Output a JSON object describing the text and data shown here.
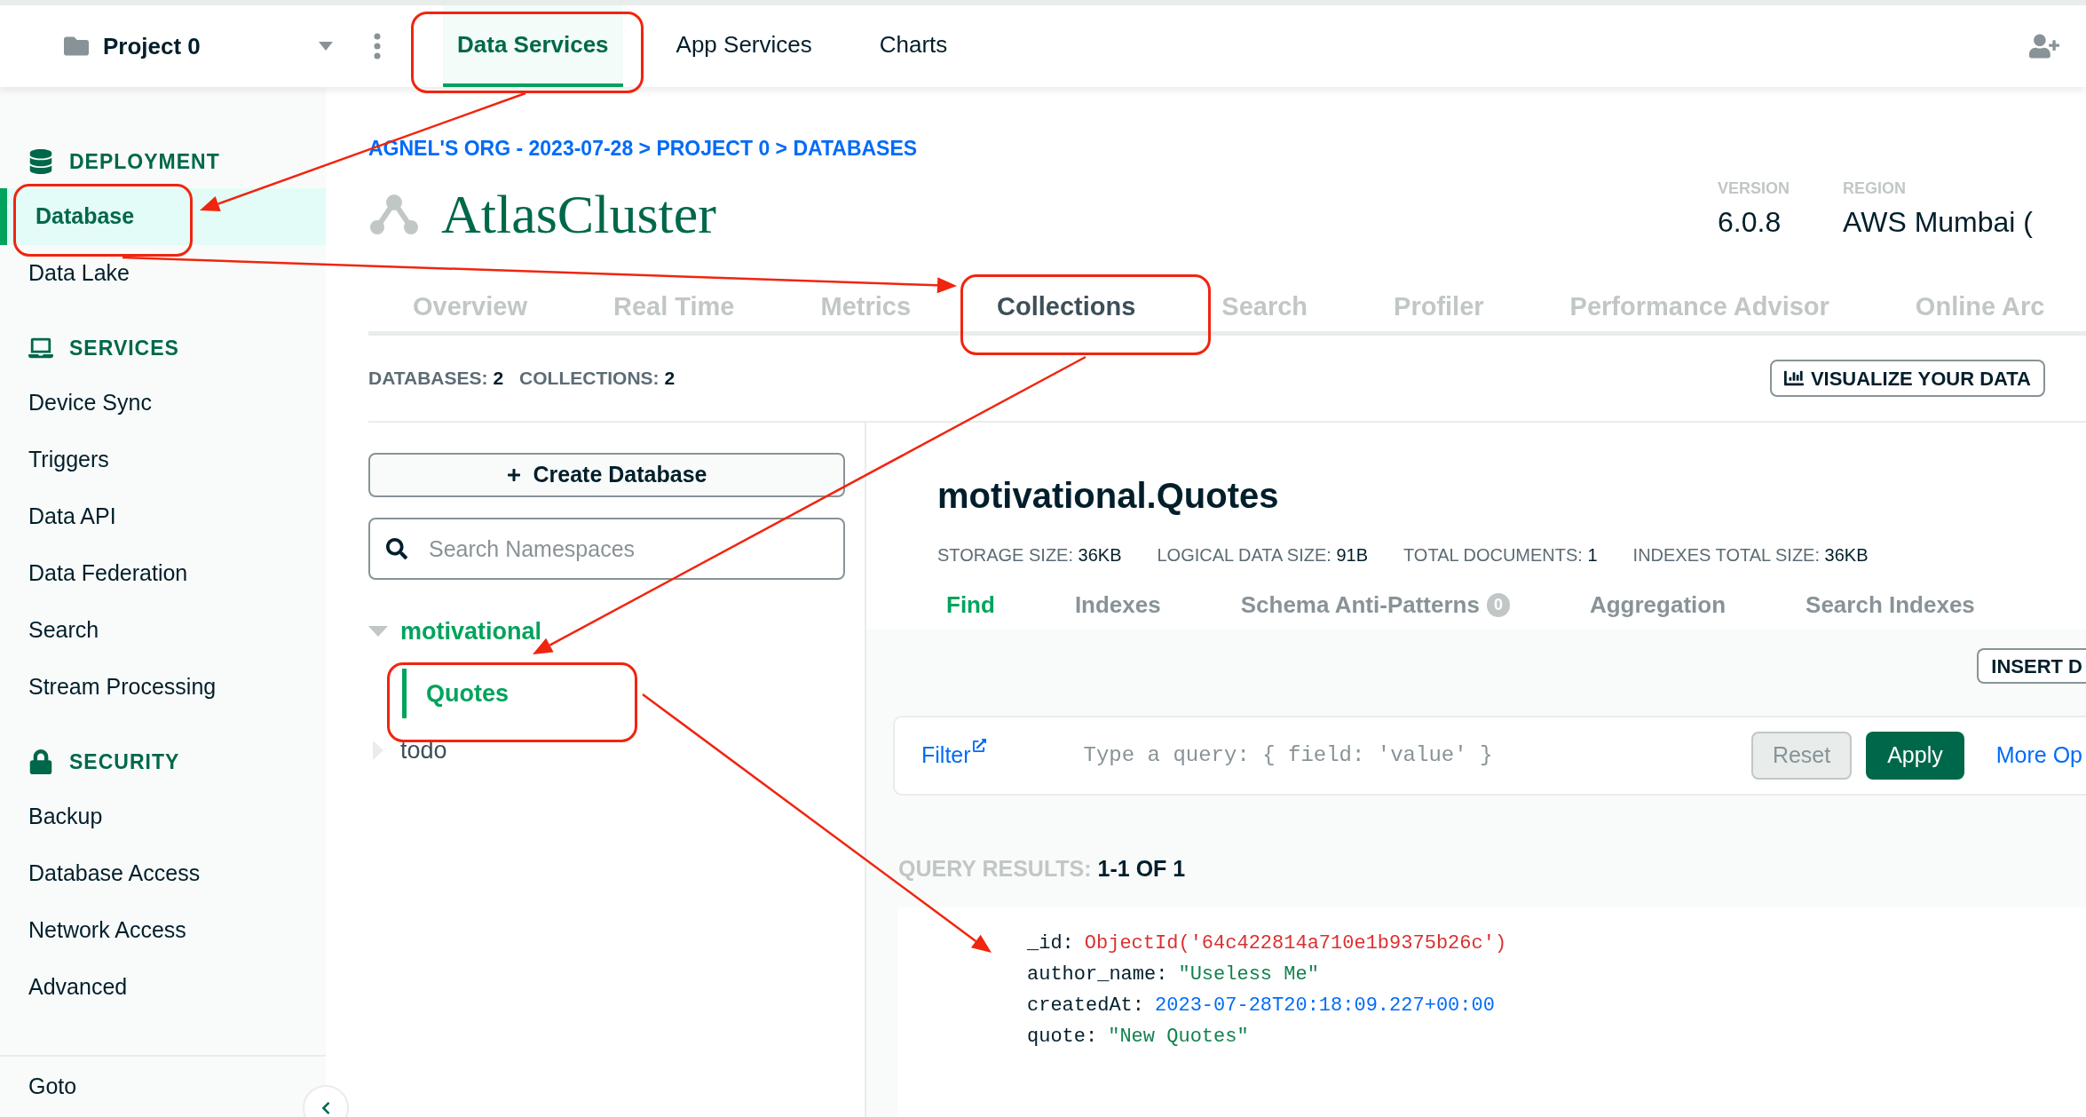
{
  "top_bar": {
    "project": "Project 0",
    "nav": [
      {
        "label": "Data Services",
        "selected": true
      },
      {
        "label": "App Services",
        "selected": false
      },
      {
        "label": "Charts",
        "selected": false
      }
    ]
  },
  "sidebar": {
    "sections": [
      {
        "title": "DEPLOYMENT",
        "kind": "database",
        "items": [
          {
            "label": "Database",
            "selected": true
          },
          {
            "label": "Data Lake",
            "selected": false
          }
        ]
      },
      {
        "title": "SERVICES",
        "kind": "laptop",
        "items": [
          {
            "label": "Device Sync",
            "selected": false
          },
          {
            "label": "Triggers",
            "selected": false
          },
          {
            "label": "Data API",
            "selected": false
          },
          {
            "label": "Data Federation",
            "selected": false
          },
          {
            "label": "Search",
            "selected": false
          },
          {
            "label": "Stream Processing",
            "selected": false
          }
        ]
      },
      {
        "title": "SECURITY",
        "kind": "lock",
        "items": [
          {
            "label": "Backup",
            "selected": false
          },
          {
            "label": "Database Access",
            "selected": false
          },
          {
            "label": "Network Access",
            "selected": false
          },
          {
            "label": "Advanced",
            "selected": false
          }
        ]
      }
    ],
    "footer": "Goto"
  },
  "breadcrumb": "AGNEL'S ORG - 2023-07-28 > PROJECT 0 > DATABASES",
  "cluster": {
    "name": "AtlasCluster",
    "meta": [
      {
        "label": "VERSION",
        "value": "6.0.8"
      },
      {
        "label": "REGION",
        "value": "AWS Mumbai ("
      }
    ]
  },
  "tabs": [
    {
      "label": "Overview",
      "selected": false
    },
    {
      "label": "Real Time",
      "selected": false
    },
    {
      "label": "Metrics",
      "selected": false
    },
    {
      "label": "Collections",
      "selected": true
    },
    {
      "label": "Search",
      "selected": false
    },
    {
      "label": "Profiler",
      "selected": false
    },
    {
      "label": "Performance Advisor",
      "selected": false
    },
    {
      "label": "Online Arc",
      "selected": false
    }
  ],
  "counts": [
    {
      "label": "DATABASES:",
      "value": "2"
    },
    {
      "label": "COLLECTIONS:",
      "value": "2"
    }
  ],
  "visualize_button": "VISUALIZE YOUR DATA",
  "create_button": "Create Database",
  "search": {
    "placeholder": "Search Namespaces"
  },
  "databases": [
    {
      "name": "motivational",
      "expanded": true,
      "children": [
        {
          "name": "Quotes",
          "selected": true
        }
      ]
    },
    {
      "name": "todo",
      "expanded": false
    }
  ],
  "collection": {
    "title": "motivational.Quotes",
    "stats": [
      {
        "label": "STORAGE SIZE:",
        "value": "36KB"
      },
      {
        "label": "LOGICAL DATA SIZE:",
        "value": "91B"
      },
      {
        "label": "TOTAL DOCUMENTS:",
        "value": "1"
      },
      {
        "label": "INDEXES TOTAL SIZE:",
        "value": "36KB"
      }
    ],
    "tabs": [
      {
        "label": "Find",
        "selected": true
      },
      {
        "label": "Indexes",
        "selected": false
      },
      {
        "label": "Schema Anti-Patterns",
        "selected": false,
        "badge": "0"
      },
      {
        "label": "Aggregation",
        "selected": false
      },
      {
        "label": "Search Indexes",
        "selected": false
      }
    ]
  },
  "insert_button": "INSERT D",
  "filter": {
    "label": "Filter",
    "placeholder": "Type a query: { field: 'value' }",
    "reset": "Reset",
    "apply": "Apply",
    "more": "More Op"
  },
  "results": {
    "label": "QUERY RESULTS:",
    "value": "1-1 OF 1"
  },
  "document": [
    {
      "key": "_id:",
      "value": "ObjectId('64c422814a710e1b9375b26c')",
      "kind": "objectid"
    },
    {
      "key": "author_name:",
      "value": "\"Useless Me\"",
      "kind": "string"
    },
    {
      "key": "createdAt:",
      "value": "2023-07-28T20:18:09.227+00:00",
      "kind": "date"
    },
    {
      "key": "quote:",
      "value": "\"New Quotes\"",
      "kind": "string"
    }
  ]
}
